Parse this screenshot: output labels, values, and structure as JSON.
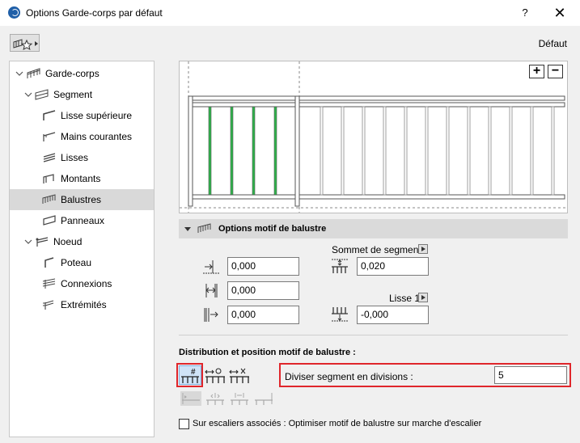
{
  "window": {
    "title": "Options Garde-corps par défaut",
    "help": "?",
    "close": "✕"
  },
  "toolbar": {
    "default_label": "Défaut"
  },
  "tree": [
    {
      "label": "Garde-corps",
      "level": 0,
      "expanded": true,
      "icon": "railing-icon"
    },
    {
      "label": "Segment",
      "level": 1,
      "expanded": true,
      "icon": "segment-icon"
    },
    {
      "label": "Lisse supérieure",
      "level": 2,
      "icon": "top-rail-icon"
    },
    {
      "label": "Mains courantes",
      "level": 2,
      "icon": "handrail-icon"
    },
    {
      "label": "Lisses",
      "level": 2,
      "icon": "rails-icon"
    },
    {
      "label": "Montants",
      "level": 2,
      "icon": "posts-icon"
    },
    {
      "label": "Balustres",
      "level": 2,
      "icon": "balusters-icon",
      "selected": true
    },
    {
      "label": "Panneaux",
      "level": 2,
      "icon": "panels-icon"
    },
    {
      "label": "Noeud",
      "level": 1,
      "expanded": true,
      "icon": "node-icon"
    },
    {
      "label": "Poteau",
      "level": 2,
      "icon": "post-icon"
    },
    {
      "label": "Connexions",
      "level": 2,
      "icon": "connections-icon"
    },
    {
      "label": "Extrémités",
      "level": 2,
      "icon": "ends-icon"
    }
  ],
  "preview": {
    "zoom_in": "+",
    "zoom_out": "−"
  },
  "pattern_options": {
    "header": "Options motif de balustre",
    "offset_start": "0,000",
    "spacing": "0,000",
    "offset_end": "0,000",
    "segment_top_label": "Sommet de segment",
    "segment_top_value": "0,020",
    "rail_label": "Lisse 1",
    "rail_value": "-0,000"
  },
  "distribution": {
    "title": "Distribution et position motif de balustre :",
    "divide_label": "Diviser segment en divisions :",
    "divide_value": "5"
  },
  "stairs_option": {
    "label": "Sur escaliers associés : Optimiser motif de balustre sur marche d'escalier",
    "checked": false
  },
  "colors": {
    "baluster_highlight": "#2db34a",
    "selection_red": "#e0262b",
    "active_blue": "#cfe3f7"
  }
}
